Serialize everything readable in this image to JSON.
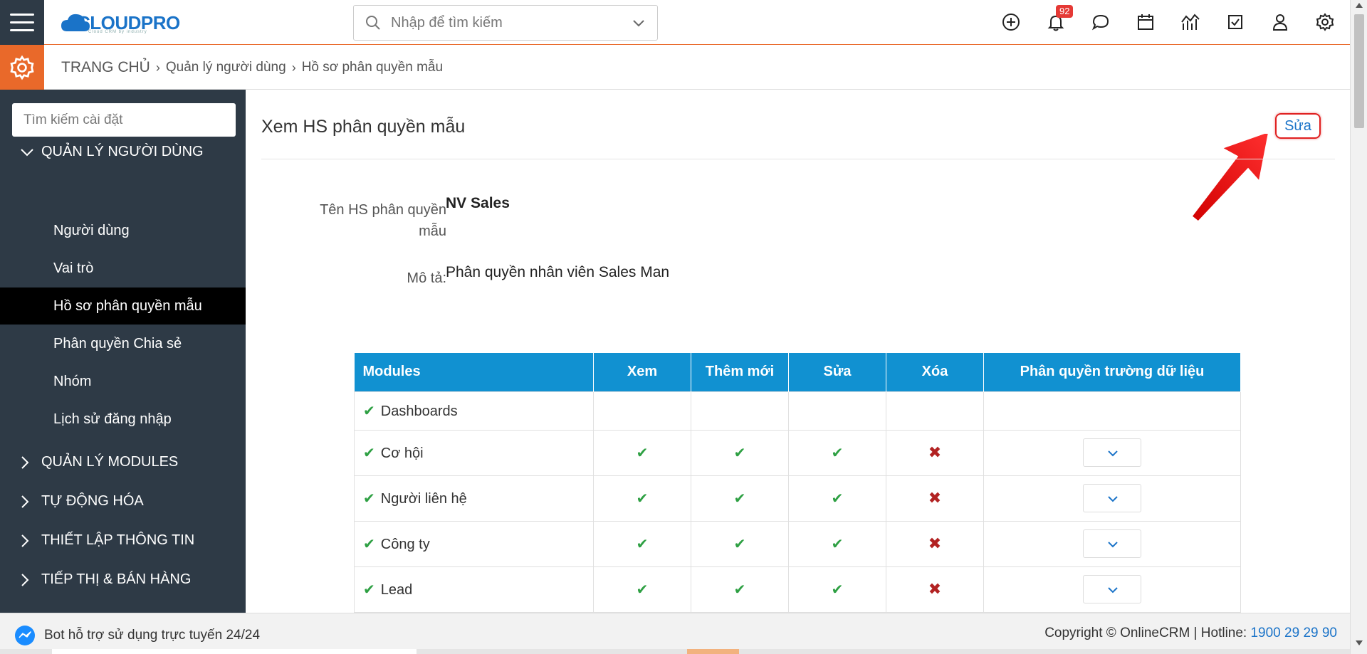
{
  "header": {
    "logo_text": "CLOUDPRO",
    "logo_sub": "Cloud CRM by industry",
    "search_placeholder": "Nhập để tìm kiếm",
    "notification_count": "92",
    "icons": [
      "plus-circle-icon",
      "bell-icon",
      "chat-icon",
      "calendar-icon",
      "chart-icon",
      "checkbox-icon",
      "user-icon",
      "gear-icon"
    ]
  },
  "breadcrumb": {
    "home": "TRANG CHỦ",
    "level1": "Quản lý người dùng",
    "level2": "Hồ sơ phân quyền mẫu"
  },
  "sidebar": {
    "search_placeholder": "Tìm kiếm cài đặt",
    "section_users": "QUẢN LÝ NGƯỜI DÙNG",
    "items": [
      "Người dùng",
      "Vai trò",
      "Hồ sơ phân quyền mẫu",
      "Phân quyền Chia sẻ",
      "Nhóm",
      "Lịch sử đăng nhập"
    ],
    "active_item": "Hồ sơ phân quyền mẫu",
    "sections": [
      "QUẢN LÝ MODULES",
      "TỰ ĐỘNG HÓA",
      "THIẾT LẬP THÔNG TIN",
      "TIẾP THỊ & BÁN HÀNG"
    ]
  },
  "main": {
    "title": "Xem HS phân quyền mẫu",
    "edit_label": "Sửa",
    "name_label_1": "Tên HS phân quyền",
    "name_label_2": "mẫu",
    "name_value": "NV Sales",
    "desc_label": "Mô tả:",
    "desc_value": "Phân quyền nhân viên Sales Man"
  },
  "table": {
    "headers": [
      "Modules",
      "Xem",
      "Thêm mới",
      "Sửa",
      "Xóa",
      "Phân quyền trường dữ liệu"
    ],
    "rows": [
      {
        "module": "Dashboards",
        "view": "",
        "add": "",
        "edit": "",
        "delete": "",
        "field": false
      },
      {
        "module": "Cơ hội",
        "view": "✔",
        "add": "✔",
        "edit": "✔",
        "delete": "✖",
        "field": true
      },
      {
        "module": "Người liên hệ",
        "view": "✔",
        "add": "✔",
        "edit": "✔",
        "delete": "✖",
        "field": true
      },
      {
        "module": "Công ty",
        "view": "✔",
        "add": "✔",
        "edit": "✔",
        "delete": "✖",
        "field": true
      },
      {
        "module": "Lead",
        "view": "✔",
        "add": "✔",
        "edit": "✔",
        "delete": "✖",
        "field": true
      }
    ]
  },
  "footer": {
    "bot_text": "Bot hỗ trợ sử dụng trực tuyến 24/24",
    "copyright": "Copyright © OnlineCRM",
    "hotline_label": "Hotline:",
    "hotline_number": "1900 29 29 90"
  },
  "colors": {
    "sidebar_bg": "#2e3a46",
    "accent_orange": "#e9692a",
    "table_header": "#1191d1",
    "link_blue": "#1a73c8",
    "check_green": "#2ea043",
    "cross_red": "#b22222"
  }
}
